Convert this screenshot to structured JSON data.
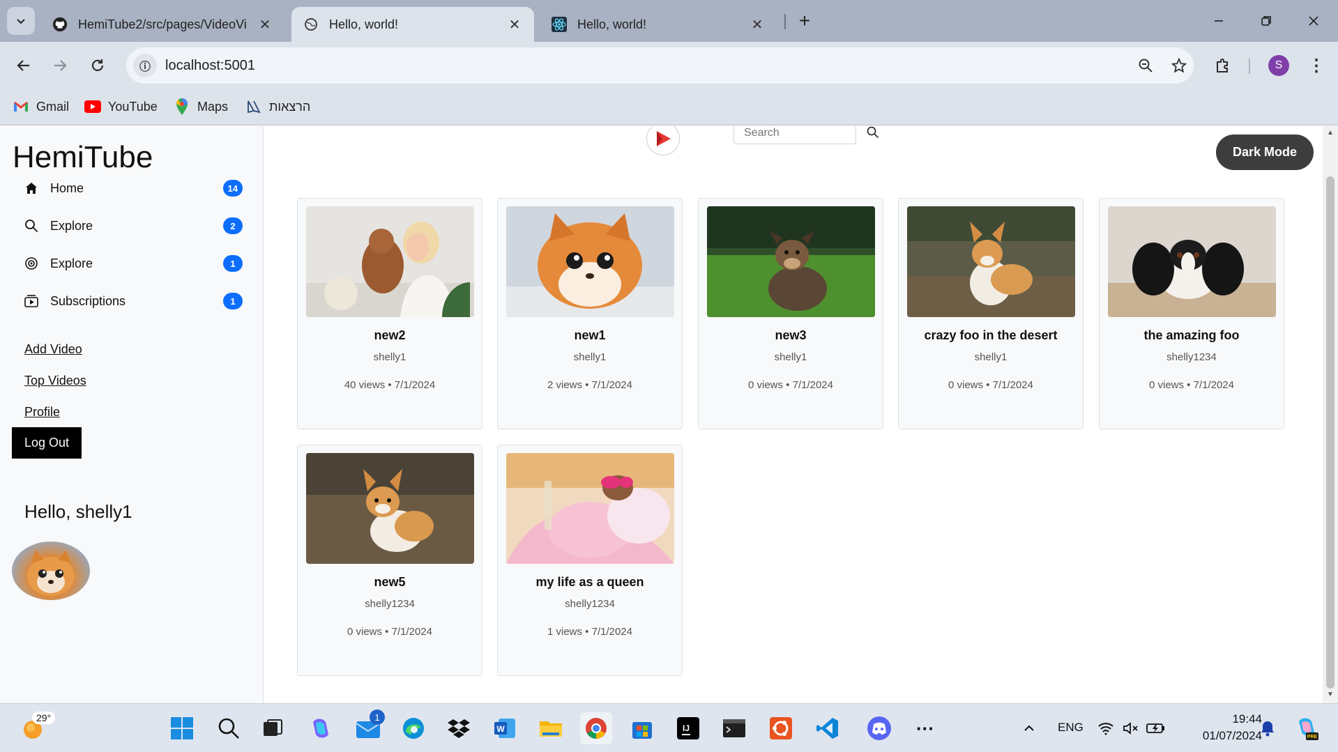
{
  "browser": {
    "tabs": [
      {
        "title": "HemiTube2/src/pages/VideoVi",
        "icon": "github-icon",
        "active": false
      },
      {
        "title": "Hello, world!",
        "icon": "globe-icon",
        "active": true
      },
      {
        "title": "Hello, world!",
        "icon": "react-icon",
        "active": false
      }
    ],
    "url": "localhost:5001",
    "profile_initial": "S",
    "bookmarks": [
      {
        "label": "Gmail",
        "icon": "gmail-icon"
      },
      {
        "label": "YouTube",
        "icon": "youtube-icon"
      },
      {
        "label": "Maps",
        "icon": "maps-icon"
      },
      {
        "label": "הרצאות",
        "icon": "drive-icon"
      }
    ]
  },
  "sidebar": {
    "brand": "HemiTube",
    "nav": [
      {
        "label": "Home",
        "icon": "home-icon",
        "badge": "14"
      },
      {
        "label": "Explore",
        "icon": "search-icon",
        "badge": "2"
      },
      {
        "label": "Explore",
        "icon": "compass-icon",
        "badge": "1"
      },
      {
        "label": "Subscriptions",
        "icon": "subscriptions-icon",
        "badge": "1"
      }
    ],
    "links": [
      "Add Video",
      "Top Videos",
      "Profile"
    ],
    "logout": "Log Out",
    "greeting": "Hello, shelly1"
  },
  "header": {
    "search_placeholder": "Search",
    "dark_mode": "Dark Mode"
  },
  "videos": [
    {
      "title": "new2",
      "author": "shelly1",
      "meta": "40 views • 7/1/2024",
      "thumb": "woman-with-poodle"
    },
    {
      "title": "new1",
      "author": "shelly1",
      "meta": "2 views • 7/1/2024",
      "thumb": "fluffy-pomeranian"
    },
    {
      "title": "new3",
      "author": "shelly1",
      "meta": "0 views • 7/1/2024",
      "thumb": "dog-on-grass"
    },
    {
      "title": "crazy foo in the desert",
      "author": "shelly1",
      "meta": "0 views • 7/1/2024",
      "thumb": "corgi-in-field"
    },
    {
      "title": "the amazing foo",
      "author": "shelly1234",
      "meta": "0 views • 7/1/2024",
      "thumb": "spaniel-lying"
    },
    {
      "title": "new5",
      "author": "shelly1234",
      "meta": "0 views • 7/1/2024",
      "thumb": "corgi-standing"
    },
    {
      "title": "my life as a queen",
      "author": "shelly1234",
      "meta": "1 views • 7/1/2024",
      "thumb": "dog-in-bathrobe"
    }
  ],
  "taskbar": {
    "weather_temp": "29°",
    "mail_badge": "1",
    "language": "ENG",
    "time": "19:44",
    "date": "01/07/2024"
  },
  "colors": {
    "tabbar": "#a9b2c3",
    "toolbar": "#dde3ea",
    "badge": "#0d6efd",
    "dark_button": "#3d3d3d"
  }
}
